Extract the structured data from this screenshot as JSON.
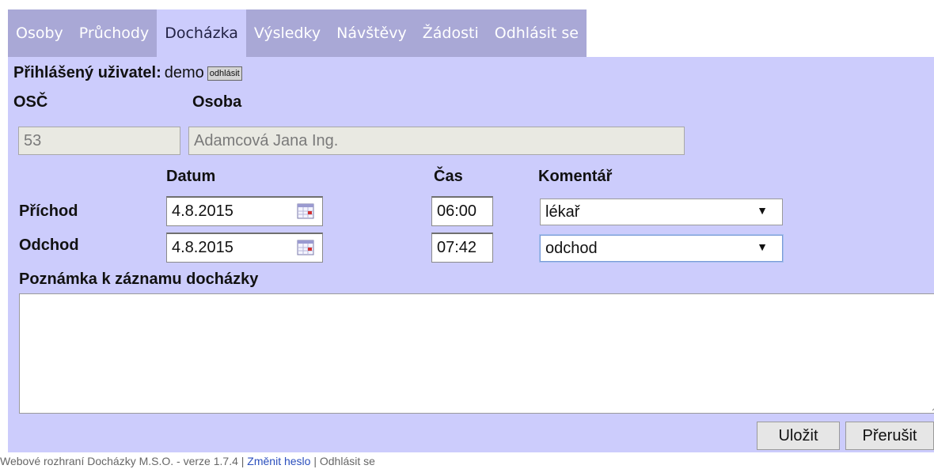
{
  "tabs": [
    {
      "label": "Osoby",
      "active": false
    },
    {
      "label": "Průchody",
      "active": false
    },
    {
      "label": "Docházka",
      "active": true
    },
    {
      "label": "Výsledky",
      "active": false
    },
    {
      "label": "Návštěvy",
      "active": false
    },
    {
      "label": "Žádosti",
      "active": false
    },
    {
      "label": "Odhlásit se",
      "active": false
    }
  ],
  "user": {
    "label": "Přihlášený uživatel:",
    "name": "demo",
    "logout_button": "odhlásit"
  },
  "person": {
    "osc_label": "OSČ",
    "osoba_label": "Osoba",
    "osc_value": "53",
    "osoba_value": "Adamcová Jana Ing."
  },
  "headers": {
    "datum": "Datum",
    "cas": "Čas",
    "komentar": "Komentář"
  },
  "arrival": {
    "label": "Příchod",
    "date": "4.8.2015",
    "time": "06:00",
    "comment": "lékař"
  },
  "departure": {
    "label": "Odchod",
    "date": "4.8.2015",
    "time": "07:42",
    "comment": "odchod"
  },
  "note": {
    "label": "Poznámka k záznamu docházky",
    "value": ""
  },
  "buttons": {
    "save": "Uložit",
    "cancel": "Přerušit"
  },
  "footer": {
    "text": "Webové rozhraní Docházky M.S.O. - verze 1.7.4",
    "sep": "|",
    "change_password": "Změnit heslo",
    "logout": "Odhlásit se"
  },
  "colors": {
    "tab_bg": "#a9a8d6",
    "tab_active_bg": "#ccccfc",
    "panel_bg": "#ccccfc",
    "link": "#2a4ebd"
  },
  "icons": {
    "date_picker": "calendar-icon",
    "dropdown": "chevron-down-icon",
    "resize": "resize-grip-icon"
  }
}
